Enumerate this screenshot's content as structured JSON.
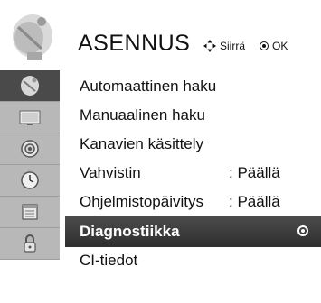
{
  "header": {
    "title": "ASENNUS",
    "hint_move_label": "Siirrä",
    "hint_ok_label": "OK",
    "icon": "antenna-satellite-icon"
  },
  "rail": [
    {
      "icon": "antenna-satellite-icon",
      "active": true
    },
    {
      "icon": "tv-screen-icon",
      "active": false
    },
    {
      "icon": "speaker-icon",
      "active": false
    },
    {
      "icon": "clock-icon",
      "active": false
    },
    {
      "icon": "calendar-icon",
      "active": false
    },
    {
      "icon": "lock-icon",
      "active": false
    }
  ],
  "menu": {
    "items": [
      {
        "label": "Automaattinen haku",
        "value": ""
      },
      {
        "label": "Manuaalinen haku",
        "value": ""
      },
      {
        "label": "Kanavien käsittely",
        "value": ""
      },
      {
        "label": "Vahvistin",
        "value": ": Päällä"
      },
      {
        "label": "Ohjelmistopäivitys",
        "value": ": Päällä"
      },
      {
        "label": "Diagnostiikka",
        "value": "",
        "selected": true
      },
      {
        "label": "CI-tiedot",
        "value": ""
      }
    ]
  }
}
